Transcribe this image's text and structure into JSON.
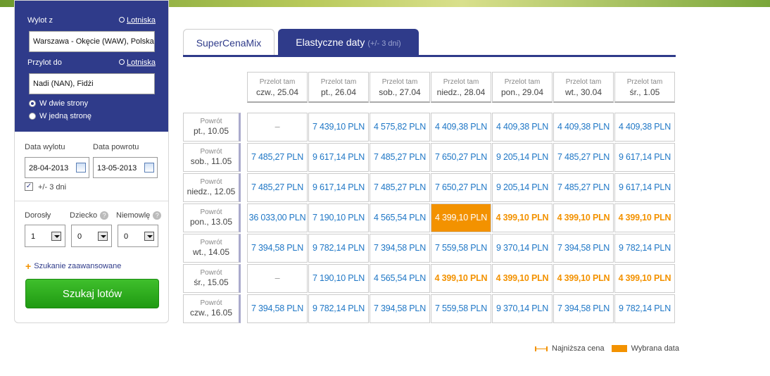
{
  "search": {
    "from_label": "Wylot z",
    "airports_link": "Lotniska",
    "from_value": "Warszawa - Okęcie (WAW), Polska",
    "to_label": "Przylot do",
    "to_value": "Nadi (NAN), Fidżi",
    "trip_roundtrip": "W dwie strony",
    "trip_oneway": "W jedną stronę",
    "depart_label": "Data wylotu",
    "return_label": "Data powrotu",
    "depart_value": "28-04-2013",
    "return_value": "13-05-2013",
    "flex_label": "+/- 3 dni",
    "adults_label": "Dorosły",
    "child_label": "Dziecko",
    "infant_label": "Niemowlę",
    "adults_value": "1",
    "child_value": "0",
    "infant_value": "0",
    "advanced_link": "Szukanie zaawansowane",
    "search_button": "Szukaj lotów"
  },
  "tabs": {
    "tab1": "SuperCenaMix",
    "tab2": "Elastyczne daty",
    "tab2_sub": "(+/- 3 dni)"
  },
  "grid": {
    "out_label": "Przelot tam",
    "ret_label": "Powrót",
    "columns": [
      "czw., 25.04",
      "pt., 26.04",
      "sob., 27.04",
      "niedz., 28.04",
      "pon., 29.04",
      "wt., 30.04",
      "śr., 1.05"
    ],
    "rows": [
      {
        "date": "pt., 10.05",
        "cells": [
          "–",
          "7 439,10 PLN",
          "4 575,82 PLN",
          "4 409,38 PLN",
          "4 409,38 PLN",
          "4 409,38 PLN",
          "4 409,38 PLN"
        ]
      },
      {
        "date": "sob., 11.05",
        "cells": [
          "7 485,27 PLN",
          "9 617,14 PLN",
          "7 485,27 PLN",
          "7 650,27 PLN",
          "9 205,14 PLN",
          "7 485,27 PLN",
          "9 617,14 PLN"
        ]
      },
      {
        "date": "niedz., 12.05",
        "cells": [
          "7 485,27 PLN",
          "9 617,14 PLN",
          "7 485,27 PLN",
          "7 650,27 PLN",
          "9 205,14 PLN",
          "7 485,27 PLN",
          "9 617,14 PLN"
        ]
      },
      {
        "date": "pon., 13.05",
        "cells": [
          "36 033,00 PLN",
          "7 190,10 PLN",
          "4 565,54 PLN",
          "4 399,10 PLN",
          "4 399,10 PLN",
          "4 399,10 PLN",
          "4 399,10 PLN"
        ]
      },
      {
        "date": "wt., 14.05",
        "cells": [
          "7 394,58 PLN",
          "9 782,14 PLN",
          "7 394,58 PLN",
          "7 559,58 PLN",
          "9 370,14 PLN",
          "7 394,58 PLN",
          "9 782,14 PLN"
        ]
      },
      {
        "date": "śr., 15.05",
        "cells": [
          "–",
          "7 190,10 PLN",
          "4 565,54 PLN",
          "4 399,10 PLN",
          "4 399,10 PLN",
          "4 399,10 PLN",
          "4 399,10 PLN"
        ]
      },
      {
        "date": "czw., 16.05",
        "cells": [
          "7 394,58 PLN",
          "9 782,14 PLN",
          "7 394,58 PLN",
          "7 559,58 PLN",
          "9 370,14 PLN",
          "7 394,58 PLN",
          "9 782,14 PLN"
        ]
      }
    ],
    "lowest_price": "4 399,10 PLN",
    "selected": {
      "row": 3,
      "col": 3
    }
  },
  "legend": {
    "lowest": "Najniższa cena",
    "selected": "Wybrana data"
  },
  "colors": {
    "brand": "#2f3b8a",
    "accent": "#f39200",
    "price": "#1f77c6",
    "search_button": "#2aa81a"
  }
}
